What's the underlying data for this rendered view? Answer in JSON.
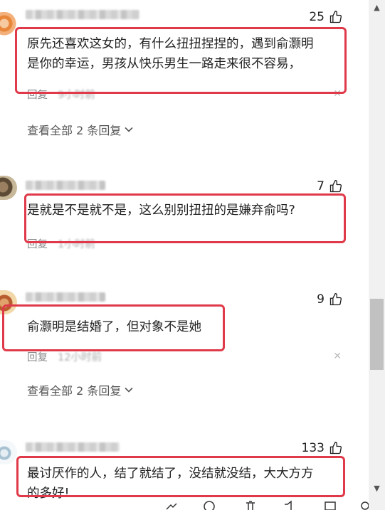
{
  "comments": [
    {
      "likes": "25",
      "text": "原先还喜欢这女的，有什么扭扭捏捏的，遇到俞灏明\n是你的幸运，男孩从快乐男生一路走来很不容易，",
      "reply_label": "回复",
      "time": "9小时前",
      "view_all": "查看全部 2 条回复"
    },
    {
      "likes": "7",
      "text": "是就是不是就不是，这么别别扭扭的是嫌弃俞吗?",
      "reply_label": "回复",
      "time": "1小时前"
    },
    {
      "likes": "9",
      "text": "俞灏明是结婚了，但对象不是她",
      "reply_label": "回复",
      "time": "12小时前",
      "view_all": "查看全部 2 条回复"
    },
    {
      "likes": "133",
      "text": "最讨厌作的人，结了就结了，没结就没结，大大方方\n的多好!"
    }
  ],
  "icons": {
    "like": "thumb-up-icon",
    "close": "close-icon",
    "chevron": "chevron-down-icon"
  },
  "colors": {
    "highlight_box": "#e03a4a",
    "meta_text": "#888888"
  }
}
